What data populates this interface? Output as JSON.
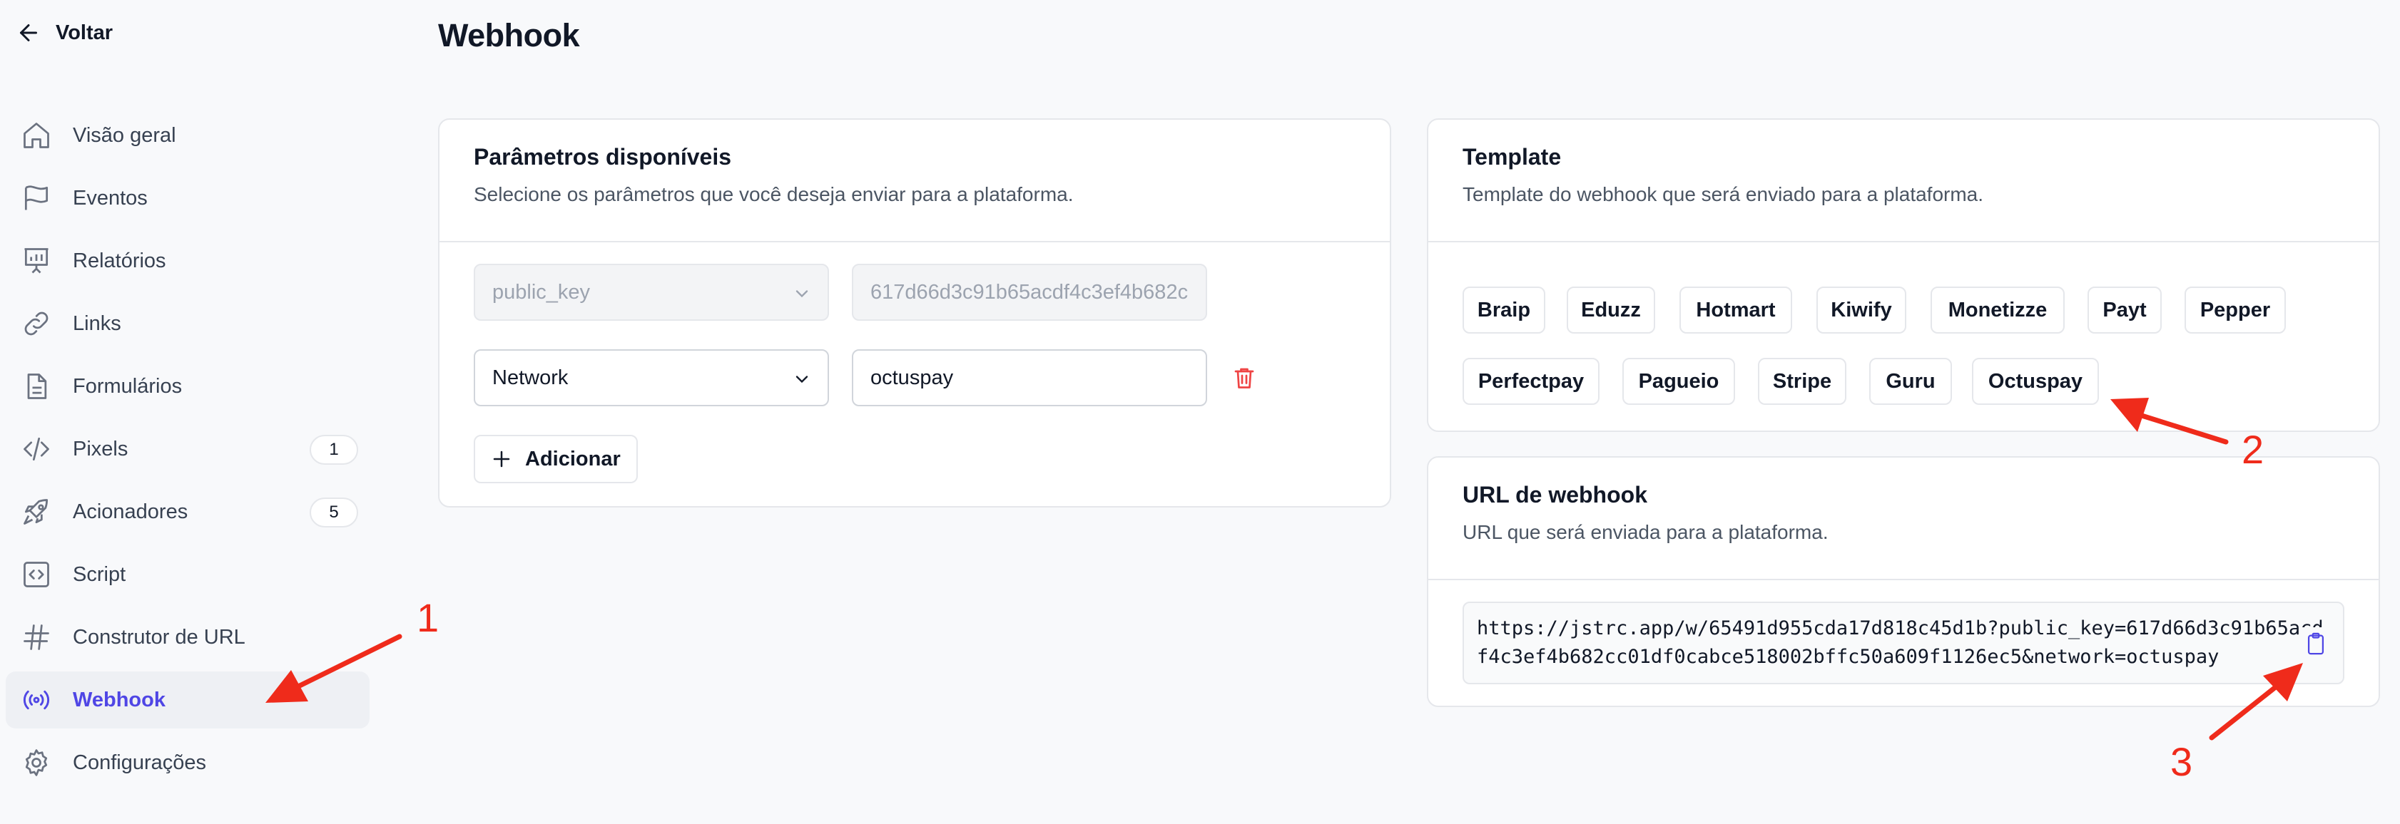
{
  "back": {
    "label": "Voltar"
  },
  "page": {
    "title": "Webhook"
  },
  "sidebar": {
    "items": [
      {
        "label": "Visão geral",
        "icon": "home-icon"
      },
      {
        "label": "Eventos",
        "icon": "flag-icon"
      },
      {
        "label": "Relatórios",
        "icon": "report-chart-icon"
      },
      {
        "label": "Links",
        "icon": "link-icon"
      },
      {
        "label": "Formulários",
        "icon": "document-icon"
      },
      {
        "label": "Pixels",
        "icon": "code-icon",
        "badge": "1"
      },
      {
        "label": "Acionadores",
        "icon": "rocket-icon",
        "badge": "5"
      },
      {
        "label": "Script",
        "icon": "code-square-icon"
      },
      {
        "label": "Construtor de URL",
        "icon": "hash-icon"
      },
      {
        "label": "Webhook",
        "icon": "broadcast-icon",
        "active": true
      },
      {
        "label": "Configurações",
        "icon": "gear-icon"
      }
    ]
  },
  "params": {
    "title": "Parâmetros disponíveis",
    "subtitle": "Selecione os parâmetros que você deseja enviar para a plataforma.",
    "rows": [
      {
        "key": "public_key",
        "value": "617d66d3c91b65acdf4c3ef4b682c",
        "disabled": true
      },
      {
        "key": "Network",
        "value": "octuspay",
        "disabled": false
      }
    ],
    "add_label": "Adicionar"
  },
  "template": {
    "title": "Template",
    "subtitle": "Template do webhook que será enviado para a plataforma.",
    "chips": [
      "Braip",
      "Eduzz",
      "Hotmart",
      "Kiwify",
      "Monetizze",
      "Payt",
      "Pepper",
      "Perfectpay",
      "Pagueio",
      "Stripe",
      "Guru",
      "Octuspay"
    ]
  },
  "url": {
    "title": "URL de webhook",
    "subtitle": "URL que será enviada para a plataforma.",
    "value": "https://jstrc.app/w/65491d955cda17d818c45d1b?public_key=617d66d3c91b65acdf4c3ef4b682cc01df0cabce518002bffc50a609f1126ec5&network=octuspay"
  },
  "annotations": [
    "1",
    "2",
    "3"
  ],
  "colors": {
    "accent": "#4f46e5",
    "danger": "#ef4444",
    "annotation": "#ef2b1b"
  }
}
